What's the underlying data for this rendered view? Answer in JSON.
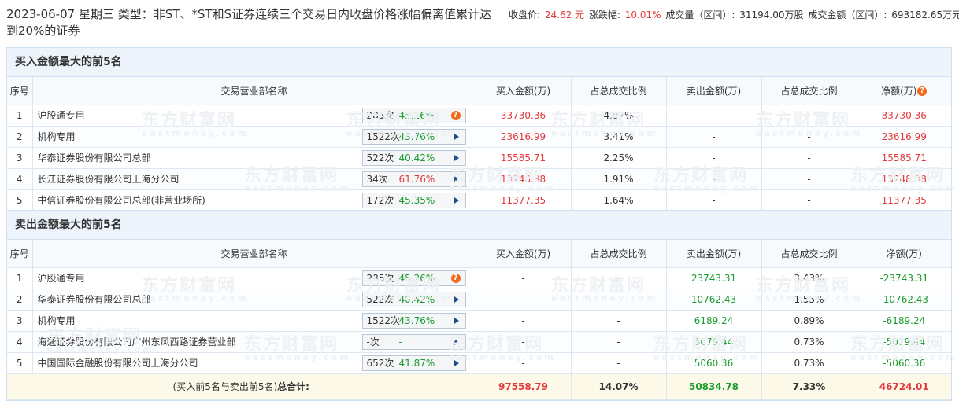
{
  "header": {
    "title": "2023-06-07 星期三 类型：非ST、*ST和S证券连续三个交易日内收盘价格涨幅偏离值累计达到20%的证券",
    "close_label": "收盘价:",
    "close_value": "24.62 元",
    "change_label": "涨跌幅:",
    "change_value": "10.01%",
    "volume_label": "成交量（区间）:",
    "volume_value": "31194.00万股",
    "amount_label": "成交金额（区间）:",
    "amount_value": "693182.65万元"
  },
  "watermark": {
    "text": "东方财富网",
    "sub": "eastmoney.com"
  },
  "columns": [
    "序号",
    "交易营业部名称",
    "买入金额(万)",
    "占总成交比例",
    "卖出金额(万)",
    "占总成交比例",
    "净额(万)"
  ],
  "buy_section": {
    "title": "买入金额最大的前5名",
    "rows": [
      {
        "idx": "1",
        "name": "沪股通专用",
        "times": "285次",
        "rate": "45.26%",
        "buy": "33730.36",
        "buy_ratio": "4.87%",
        "sell": "-",
        "sell_ratio": "-",
        "net": "33730.36",
        "icon": "question"
      },
      {
        "idx": "2",
        "name": "机构专用",
        "times": "1522次",
        "rate": "43.76%",
        "buy": "23616.99",
        "buy_ratio": "3.41%",
        "sell": "-",
        "sell_ratio": "-",
        "net": "23616.99",
        "icon": "arrow"
      },
      {
        "idx": "3",
        "name": "华泰证券股份有限公司总部",
        "times": "522次",
        "rate": "40.42%",
        "buy": "15585.71",
        "buy_ratio": "2.25%",
        "sell": "-",
        "sell_ratio": "-",
        "net": "15585.71",
        "icon": "arrow"
      },
      {
        "idx": "4",
        "name": "长江证券股份有限公司上海分公司",
        "times": "34次",
        "rate": "61.76%",
        "buy": "13248.38",
        "buy_ratio": "1.91%",
        "sell": "-",
        "sell_ratio": "-",
        "net": "13248.38",
        "icon": "arrow"
      },
      {
        "idx": "5",
        "name": "中信证券股份有限公司总部(非营业场所)",
        "times": "172次",
        "rate": "45.35%",
        "buy": "11377.35",
        "buy_ratio": "1.64%",
        "sell": "-",
        "sell_ratio": "-",
        "net": "11377.35",
        "icon": "arrow"
      }
    ]
  },
  "sell_section": {
    "title": "卖出金额最大的前5名",
    "rows": [
      {
        "idx": "1",
        "name": "沪股通专用",
        "times": "285次",
        "rate": "45.26%",
        "buy": "-",
        "buy_ratio": "-",
        "sell": "23743.31",
        "sell_ratio": "3.43%",
        "net": "-23743.31",
        "icon": "question"
      },
      {
        "idx": "2",
        "name": "华泰证券股份有限公司总部",
        "times": "522次",
        "rate": "40.42%",
        "buy": "-",
        "buy_ratio": "-",
        "sell": "10762.43",
        "sell_ratio": "1.55%",
        "net": "-10762.43",
        "icon": "arrow"
      },
      {
        "idx": "3",
        "name": "机构专用",
        "times": "1522次",
        "rate": "43.76%",
        "buy": "-",
        "buy_ratio": "-",
        "sell": "6189.24",
        "sell_ratio": "0.89%",
        "net": "-6189.24",
        "icon": "arrow"
      },
      {
        "idx": "4",
        "name": "海通证券股份有限公司广州东风西路证券营业部",
        "times": "-次",
        "rate": "-",
        "buy": "-",
        "buy_ratio": "-",
        "sell": "5079.44",
        "sell_ratio": "0.73%",
        "net": "-5079.44",
        "icon": "arrow"
      },
      {
        "idx": "5",
        "name": "中国国际金融股份有限公司上海分公司",
        "times": "652次",
        "rate": "41.87%",
        "buy": "-",
        "buy_ratio": "-",
        "sell": "5060.36",
        "sell_ratio": "0.73%",
        "net": "-5060.36",
        "icon": "arrow"
      }
    ],
    "total": {
      "label_prefix": "(买入前5名与卖出前5名)",
      "label_bold": "总合计:",
      "buy": "97558.79",
      "buy_ratio": "14.07%",
      "sell": "50834.78",
      "sell_ratio": "7.33%",
      "net": "46724.01"
    }
  },
  "colors": {
    "red": "#e4393c",
    "green": "#1a9c2e",
    "orange_icon": "#f26b1d",
    "header_bg": "#eef4fb",
    "total_bg": "#fdf9e8"
  },
  "icons": {
    "question": "question-mark-icon",
    "arrow": "arrow-right-icon"
  }
}
